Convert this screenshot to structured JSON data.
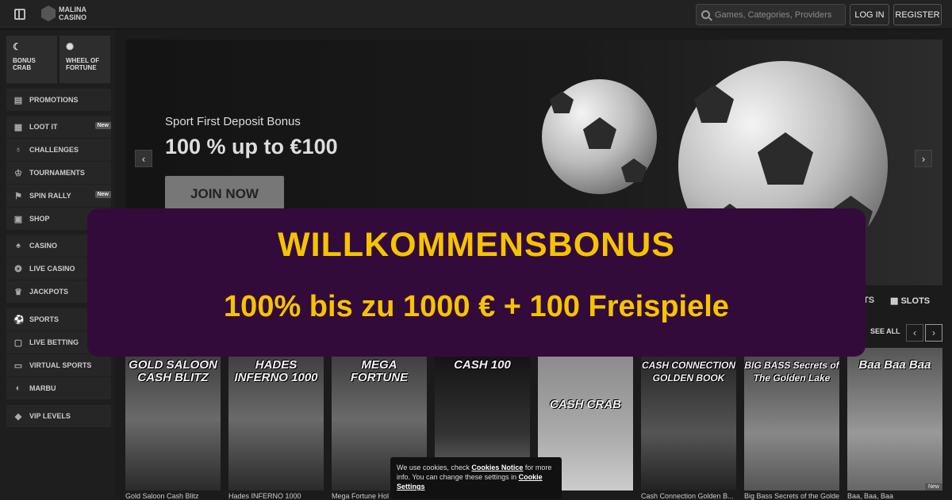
{
  "header": {
    "logo_line1": "MALINA",
    "logo_line2": "CASINO",
    "search_placeholder": "Games, Categories, Providers",
    "login_label": "LOG IN",
    "register_label": "REGISTER"
  },
  "sidebar": {
    "tiles": [
      {
        "label": "BONUS CRAB",
        "icon": "crab-icon"
      },
      {
        "label": "WHEEL OF FORTUNE",
        "icon": "wheel-icon"
      }
    ],
    "group1": [
      {
        "label": "PROMOTIONS",
        "icon": "gift-icon"
      }
    ],
    "group2": [
      {
        "label": "LOOT IT",
        "icon": "chest-icon",
        "badge": "New"
      },
      {
        "label": "CHALLENGES",
        "icon": "medal-icon"
      },
      {
        "label": "TOURNAMENTS",
        "icon": "trophy-icon"
      },
      {
        "label": "SPIN RALLY",
        "icon": "flag-icon",
        "badge": "New"
      },
      {
        "label": "SHOP",
        "icon": "shop-icon"
      }
    ],
    "group3": [
      {
        "label": "CASINO",
        "icon": "cards-icon"
      },
      {
        "label": "LIVE CASINO",
        "icon": "chip-icon"
      },
      {
        "label": "JACKPOTS",
        "icon": "crown-icon"
      }
    ],
    "group4": [
      {
        "label": "SPORTS",
        "icon": "soccer-icon"
      },
      {
        "label": "LIVE BETTING",
        "icon": "live-icon"
      },
      {
        "label": "VIRTUAL SPORTS",
        "icon": "monitor-icon"
      },
      {
        "label": "MARBU",
        "icon": "marbu-icon"
      }
    ],
    "group5": [
      {
        "label": "VIP LEVELS",
        "icon": "diamond-icon"
      }
    ]
  },
  "hero": {
    "subtitle": "Sport First Deposit Bonus",
    "title": "100 % up to €100",
    "cta": "JOIN NOW"
  },
  "games_row": {
    "tab_partial": "TS",
    "tab_slots": "SLOTS",
    "see_all": "SEE ALL",
    "prev": "‹",
    "next": "›",
    "games": [
      {
        "logo": "GOLD SALOON CASH BLITZ",
        "name": "Gold Saloon Cash Blitz"
      },
      {
        "logo": "HADES INFERNO 1000",
        "name": "Hades INFERNO 1000"
      },
      {
        "logo": "MEGA FORTUNE",
        "name": "Mega Fortune Hol"
      },
      {
        "logo": "CASH 100",
        "name": ""
      },
      {
        "logo": "CASH CRAB",
        "name": "rab"
      },
      {
        "logo": "CASH CONNECTION GOLDEN BOOK",
        "name": "Cash Connection Golden B..."
      },
      {
        "logo": "BIG BASS Secrets of The Golden Lake",
        "name": "Big Bass Secrets of the Golden L..."
      },
      {
        "logo": "Baa Baa Baa",
        "name": "Baa, Baa, Baa",
        "badge": "New"
      }
    ]
  },
  "overlay": {
    "line1": "WILLKOMMENSBONUS",
    "line2": "100% bis zu 1000 € + 100 Freispiele"
  },
  "cookie": {
    "text1": "We use cookies, check ",
    "link1": "Cookies Notice",
    "text2": " for more info. You can change these settings in ",
    "link2": "Cookie Settings"
  },
  "colors": {
    "overlay_bg": "#330b3a",
    "overlay_text": "#f5c400"
  }
}
